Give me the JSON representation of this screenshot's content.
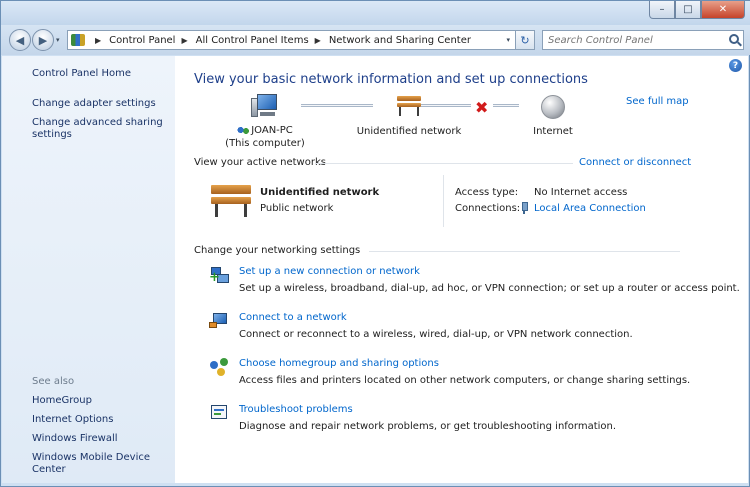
{
  "titlebar": {
    "ghost_text": "",
    "minimize": "–",
    "maximize": "□",
    "close": "✕"
  },
  "nav": {
    "back": "◀",
    "forward": "▶",
    "recent": "▾",
    "breadcrumb": [
      "Control Panel",
      "All Control Panel Items",
      "Network and Sharing Center"
    ],
    "separator": "▶",
    "address_drop": "▾",
    "refresh": "↻",
    "search_placeholder": "Search Control Panel"
  },
  "sidebar": {
    "home": "Control Panel Home",
    "links": [
      "Change adapter settings",
      "Change advanced sharing settings"
    ],
    "see_also_label": "See also",
    "see_also": [
      "HomeGroup",
      "Internet Options",
      "Windows Firewall",
      "Windows Mobile Device Center"
    ]
  },
  "main": {
    "help": "?",
    "title": "View your basic network information and set up connections",
    "see_full_map": "See full map",
    "map": {
      "computer_name": "JOAN-PC",
      "computer_sub": "(This computer)",
      "network": "Unidentified network",
      "internet": "Internet",
      "broken_mark": "✖"
    },
    "active_networks": {
      "label": "View your active networks",
      "connect_link": "Connect or disconnect",
      "name": "Unidentified network",
      "type": "Public network",
      "access_label": "Access type:",
      "access_value": "No Internet access",
      "connections_label": "Connections:",
      "connections_value": "Local Area Connection"
    },
    "settings": {
      "label": "Change your networking settings",
      "tasks": [
        {
          "title": "Set up a new connection or network",
          "desc": "Set up a wireless, broadband, dial-up, ad hoc, or VPN connection; or set up a router or access point."
        },
        {
          "title": "Connect to a network",
          "desc": "Connect or reconnect to a wireless, wired, dial-up, or VPN network connection."
        },
        {
          "title": "Choose homegroup and sharing options",
          "desc": "Access files and printers located on other network computers, or change sharing settings."
        },
        {
          "title": "Troubleshoot problems",
          "desc": "Diagnose and repair network problems, or get troubleshooting information."
        }
      ]
    }
  }
}
